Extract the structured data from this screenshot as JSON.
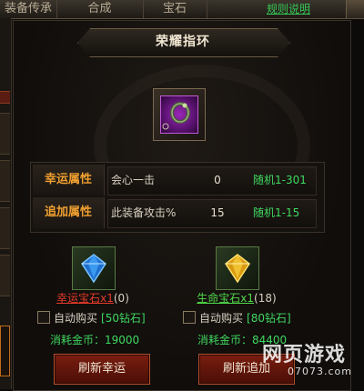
{
  "tabs": [
    {
      "label": "装备传承"
    },
    {
      "label": "合成"
    },
    {
      "label": "宝石"
    }
  ],
  "rules_link": "规则说明",
  "panel": {
    "title": "荣耀指环"
  },
  "attributes": [
    {
      "label": "幸运属性",
      "name": "会心一击",
      "value": "0",
      "range": "随机1-301"
    },
    {
      "label": "追加属性",
      "name": "此装备攻击%",
      "value": "15",
      "range": "随机1-15"
    }
  ],
  "stones": {
    "lucky": {
      "name": "幸运宝石x1",
      "count": "(0)",
      "autobuy_label": "自动购买",
      "autobuy_price": "[50钻石]",
      "cost": "消耗金币：19000",
      "button": "刷新幸运"
    },
    "life": {
      "name": "生命宝石x1",
      "count": "(18)",
      "autobuy_label": "自动购买",
      "autobuy_price": "[80钻石]",
      "cost": "消耗金币：84400",
      "button": "刷新追加"
    }
  },
  "brand": {
    "logo": "网页游戏",
    "site": "07073.com"
  },
  "colors": {
    "accent_green": "#3fd860",
    "label_orange": "#f0a030",
    "lucky_red": "#e63a2a",
    "button_red": "#7a1e10",
    "item_purple": "#9a28b8"
  },
  "icons": [
    "ring-icon",
    "blue-gem-icon",
    "yellow-gem-icon",
    "checkbox-icon"
  ]
}
